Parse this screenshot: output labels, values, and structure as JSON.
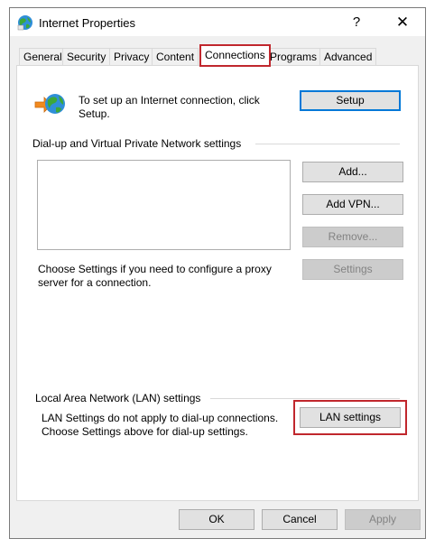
{
  "window": {
    "title": "Internet Properties",
    "help_glyph": "?",
    "close_glyph": "✕"
  },
  "tabs": [
    {
      "label": "General",
      "active": false
    },
    {
      "label": "Security",
      "active": false
    },
    {
      "label": "Privacy",
      "active": false
    },
    {
      "label": "Content",
      "active": false
    },
    {
      "label": "Connections",
      "active": true
    },
    {
      "label": "Programs",
      "active": false
    },
    {
      "label": "Advanced",
      "active": false
    }
  ],
  "setup": {
    "description": [
      "To set up an Internet connection, click",
      "Setup."
    ],
    "button": "Setup"
  },
  "dialup": {
    "heading": "Dial-up and Virtual Private Network settings",
    "add_button": "Add...",
    "add_vpn_button": "Add VPN...",
    "remove_button": "Remove...",
    "settings_button": "Settings",
    "proxy_hint": [
      "Choose Settings if you need to configure a proxy",
      "server for a connection."
    ]
  },
  "lan": {
    "heading": "Local Area Network (LAN) settings",
    "description": [
      "LAN Settings do not apply to dial-up connections.",
      "Choose Settings above for dial-up settings."
    ],
    "button": "LAN settings"
  },
  "footer": {
    "ok": "OK",
    "cancel": "Cancel",
    "apply": "Apply"
  },
  "colors": {
    "highlight": "#c0272d",
    "default_button_border": "#0078d7"
  }
}
